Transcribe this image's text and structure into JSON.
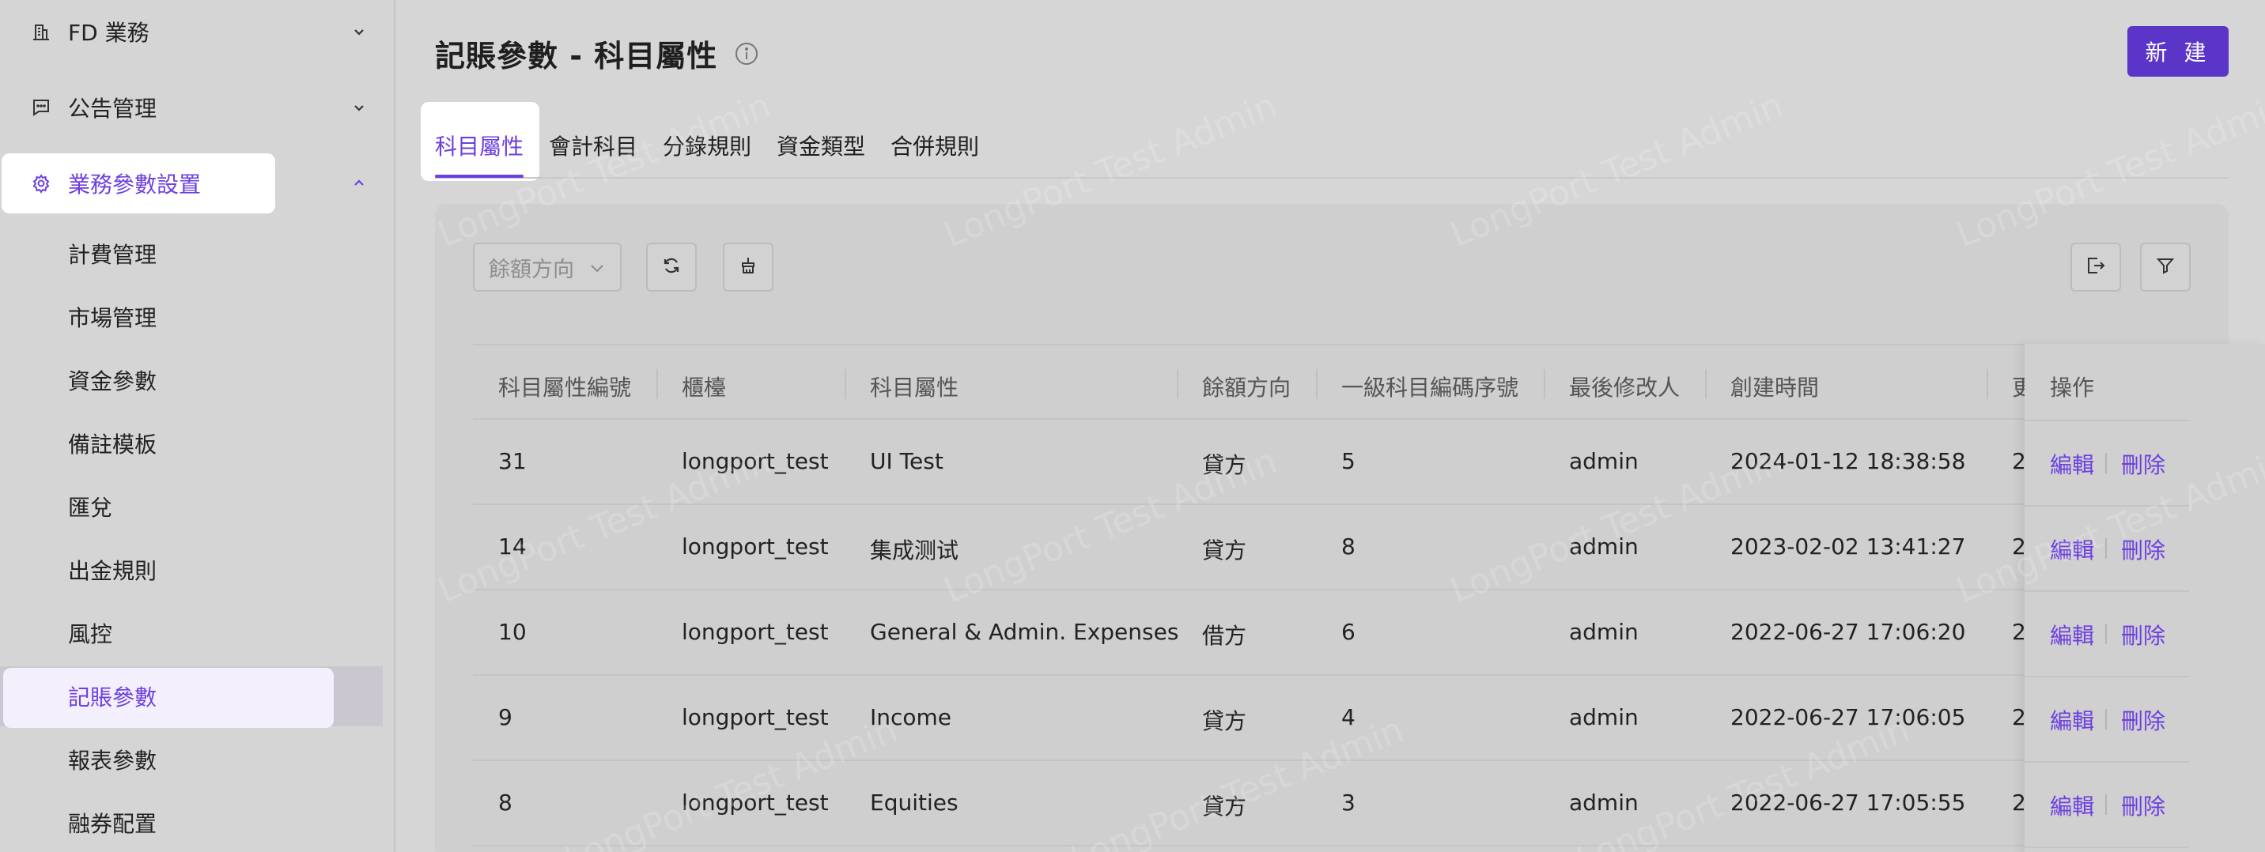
{
  "sidebar": {
    "groups": [
      {
        "label": "FD 業務",
        "icon": "building-icon"
      },
      {
        "label": "公告管理",
        "icon": "message-icon"
      },
      {
        "label": "業務參數設置",
        "icon": "gear-icon"
      }
    ],
    "sub_items": [
      "計費管理",
      "市場管理",
      "資金參數",
      "備註模板",
      "匯兌",
      "出金規則",
      "風控",
      "記賬參數",
      "報表參數",
      "融券配置"
    ],
    "active_sub_item": "記賬參數"
  },
  "header": {
    "title": "記賬參數 - 科目屬性",
    "new_button": "新 建"
  },
  "tabs": [
    "科目屬性",
    "會計科目",
    "分錄規則",
    "資金類型",
    "合併規則"
  ],
  "active_tab": "科目屬性",
  "toolbar": {
    "filter_placeholder": "餘額方向"
  },
  "table": {
    "columns": [
      "科目屬性編號",
      "櫃檯",
      "科目屬性",
      "餘額方向",
      "一級科目編碼序號",
      "最後修改人",
      "創建時間",
      "更",
      "操作"
    ],
    "rows": [
      {
        "id": "31",
        "counter": "longport_test",
        "attr": "UI Test",
        "direction": "貸方",
        "seq": "5",
        "modifier": "admin",
        "created": "2024-01-12 18:38:58",
        "updated": "2"
      },
      {
        "id": "14",
        "counter": "longport_test",
        "attr": "集成测试",
        "direction": "貸方",
        "seq": "8",
        "modifier": "admin",
        "created": "2023-02-02 13:41:27",
        "updated": "2"
      },
      {
        "id": "10",
        "counter": "longport_test",
        "attr": "General & Admin. Expenses",
        "direction": "借方",
        "seq": "6",
        "modifier": "admin",
        "created": "2022-06-27 17:06:20",
        "updated": "2"
      },
      {
        "id": "9",
        "counter": "longport_test",
        "attr": "Income",
        "direction": "貸方",
        "seq": "4",
        "modifier": "admin",
        "created": "2022-06-27 17:06:05",
        "updated": "2"
      },
      {
        "id": "8",
        "counter": "longport_test",
        "attr": "Equities",
        "direction": "貸方",
        "seq": "3",
        "modifier": "admin",
        "created": "2022-06-27 17:05:55",
        "updated": "2"
      }
    ],
    "actions": {
      "edit": "編輯",
      "delete": "刪除"
    }
  },
  "watermark_text": "LongPort Test Admin",
  "colors": {
    "accent": "#6c3fe0",
    "primary_button": "#5a35c8"
  }
}
